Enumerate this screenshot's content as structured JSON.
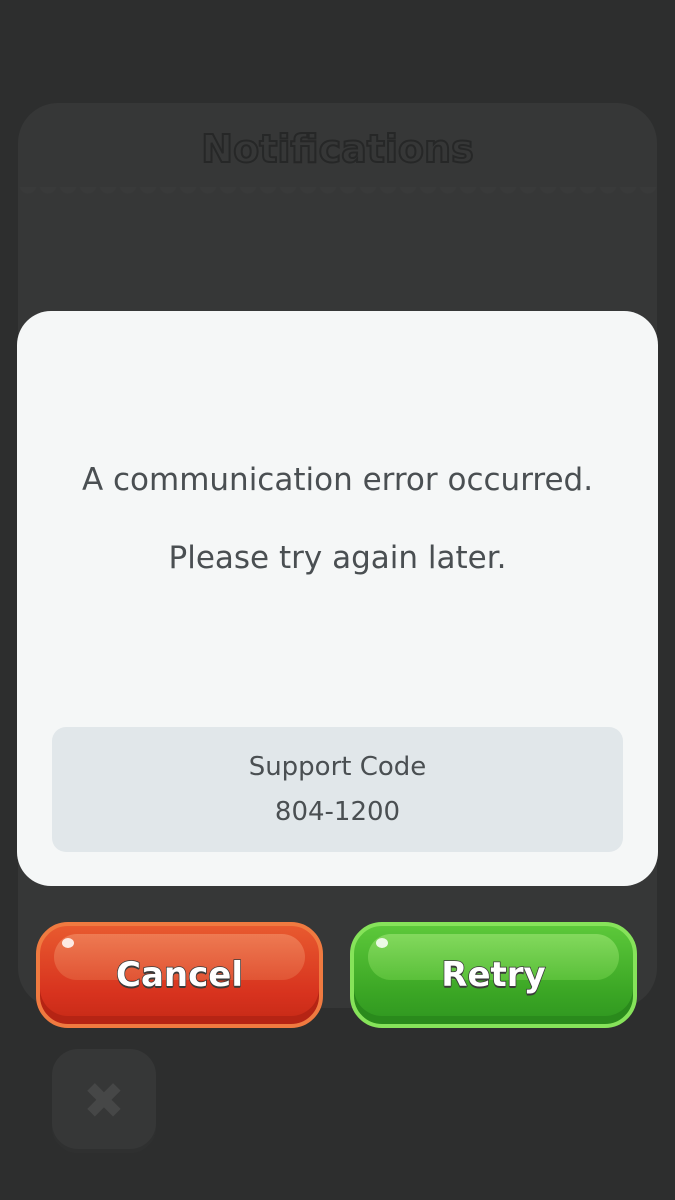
{
  "background": {
    "panel_title": "Notifications",
    "close_icon": "close-icon"
  },
  "dialog": {
    "message_line1": "A communication error occurred.",
    "message_line2": "Please try again later.",
    "support_label": "Support Code",
    "support_code": "804-1200"
  },
  "buttons": {
    "cancel_label": "Cancel",
    "retry_label": "Retry"
  },
  "colors": {
    "cancel": "#d7321e",
    "retry": "#3aa524",
    "dialog_bg": "#f5f7f7",
    "support_bg": "#e1e7ea"
  }
}
